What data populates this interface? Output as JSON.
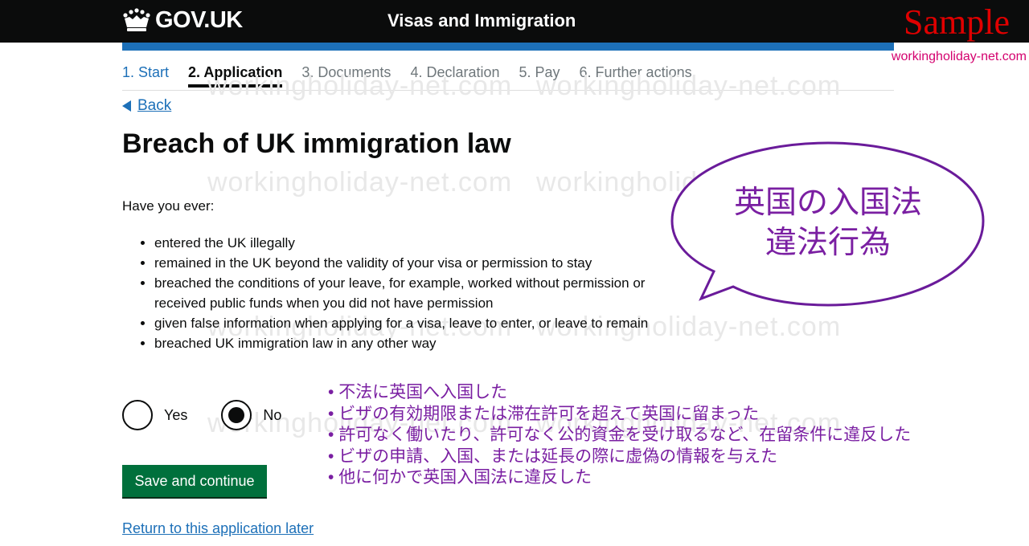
{
  "header": {
    "brand": "GOV.UK",
    "service": "Visas and Immigration",
    "sample_label": "Sample",
    "site_tag": "workingholiday-net.com"
  },
  "steps": [
    {
      "label": "1. Start",
      "state": "done"
    },
    {
      "label": "2. Application",
      "state": "current"
    },
    {
      "label": "3. Documents",
      "state": "upcoming"
    },
    {
      "label": "4. Declaration",
      "state": "upcoming"
    },
    {
      "label": "5. Pay",
      "state": "upcoming"
    },
    {
      "label": "6. Further actions",
      "state": "upcoming"
    }
  ],
  "back_label": "Back",
  "page_title": "Breach of UK immigration law",
  "intro": "Have you ever:",
  "bullets": [
    "entered the UK illegally",
    "remained in the UK beyond the validity of your visa or permission to stay",
    "breached the conditions of your leave, for example, worked without permission or received public funds when you did not have permission",
    "given false information when applying for a visa, leave to enter, or leave to remain",
    "breached UK immigration law in any other way"
  ],
  "radios": {
    "yes_label": "Yes",
    "no_label": "No",
    "selected": "No"
  },
  "save_button": "Save and continue",
  "return_link": "Return to this application later",
  "annotation": {
    "bubble_line1": "英国の入国法",
    "bubble_line2": "違法行為",
    "notes": [
      "不法に英国へ入国した",
      "ビザの有効期限または滞在許可を超えて英国に留まった",
      "許可なく働いたり、許可なく公的資金を受け取るなど、在留条件に違反した",
      "ビザの申請、入国、または延長の際に虚偽の情報を与えた",
      "他に何かで英国入国法に違反した"
    ]
  },
  "watermark_text": "workingholiday-net.com",
  "colors": {
    "header_bg": "#0b0c0c",
    "gov_blue": "#1d70b8",
    "button_green": "#00703c",
    "annotation_purple": "#7a1fa2",
    "sample_red": "#e00000",
    "site_tag_pink": "#d4006e"
  }
}
